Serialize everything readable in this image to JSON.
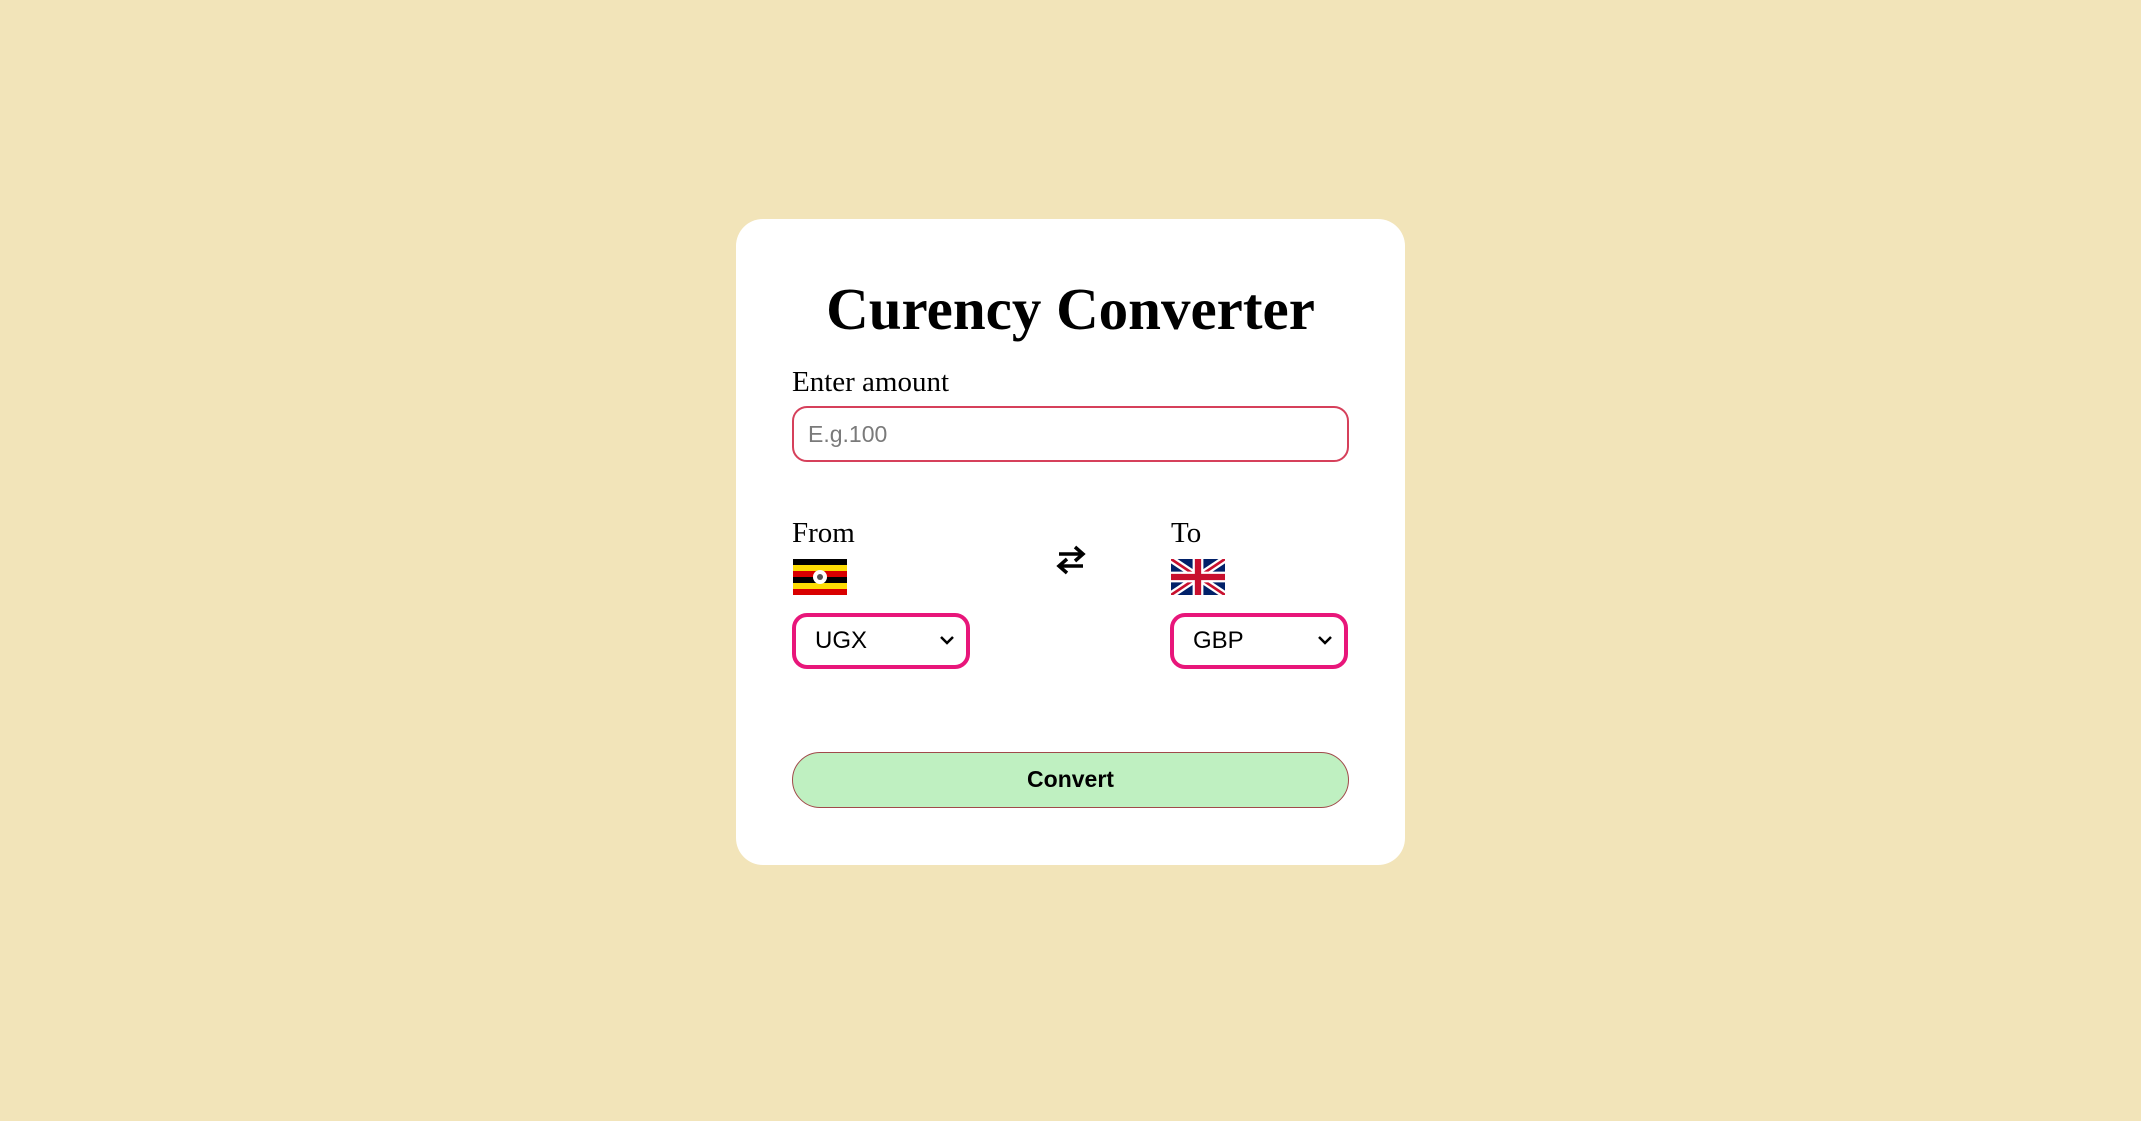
{
  "app": {
    "title": "Curency Converter"
  },
  "amount": {
    "label": "Enter amount",
    "placeholder": "E.g.100",
    "value": ""
  },
  "from": {
    "label": "From",
    "currency": "UGX",
    "flag_icon": "uganda-flag-icon"
  },
  "to": {
    "label": "To",
    "currency": "GBP",
    "flag_icon": "uk-flag-icon"
  },
  "swap": {
    "icon": "swap-arrows-icon"
  },
  "convert": {
    "label": "Convert"
  },
  "colors": {
    "background": "#f2e4b9",
    "card": "#ffffff",
    "input_border": "#d6405b",
    "select_border": "#e8167a",
    "convert_button": "#bff0c1"
  }
}
